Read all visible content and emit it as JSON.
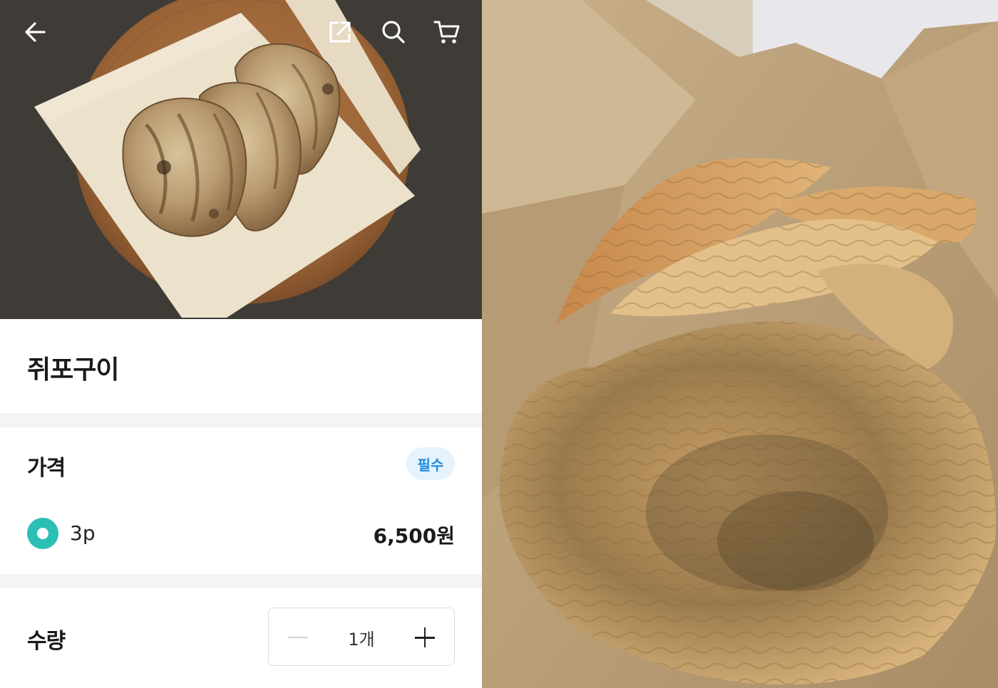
{
  "product": {
    "title": "쥐포구이"
  },
  "topbar": {
    "icons": [
      "arrow-left-icon",
      "share-icon",
      "search-icon",
      "cart-icon"
    ]
  },
  "price_section": {
    "title": "가격",
    "required_badge": "필수",
    "option": {
      "label": "3p",
      "price": "6,500원",
      "selected": true
    }
  },
  "quantity_section": {
    "title": "수량",
    "value": "1개"
  },
  "colors": {
    "accent_teal": "#2bbfb5",
    "badge_blue": "#1d8ae0",
    "badge_bg": "#e6f3fd"
  }
}
